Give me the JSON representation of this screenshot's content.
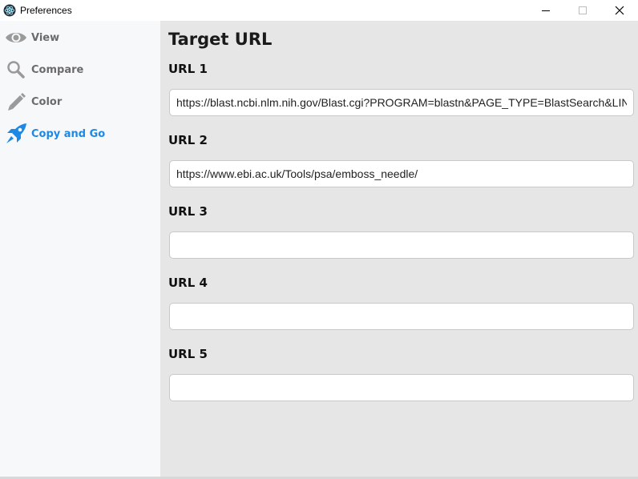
{
  "window": {
    "title": "Preferences"
  },
  "sidebar": {
    "items": [
      {
        "label": "View",
        "icon": "eye-icon",
        "active": false
      },
      {
        "label": "Compare",
        "icon": "magnifier-icon",
        "active": false
      },
      {
        "label": "Color",
        "icon": "pencil-icon",
        "active": false
      },
      {
        "label": "Copy and Go",
        "icon": "rocket-icon",
        "active": true
      }
    ]
  },
  "main": {
    "title": "Target URL",
    "urls": [
      {
        "label": "URL 1",
        "value": "https://blast.ncbi.nlm.nih.gov/Blast.cgi?PROGRAM=blastn&PAGE_TYPE=BlastSearch&LINK_LOC=blasthome"
      },
      {
        "label": "URL 2",
        "value": "https://www.ebi.ac.uk/Tools/psa/emboss_needle/"
      },
      {
        "label": "URL 3",
        "value": ""
      },
      {
        "label": "URL 4",
        "value": ""
      },
      {
        "label": "URL 5",
        "value": ""
      }
    ]
  },
  "colors": {
    "accent": "#1e88e5",
    "sidebar_bg": "#f7f8fa",
    "main_bg": "#e6e6e6",
    "inactive_text": "#6b6b6b"
  }
}
